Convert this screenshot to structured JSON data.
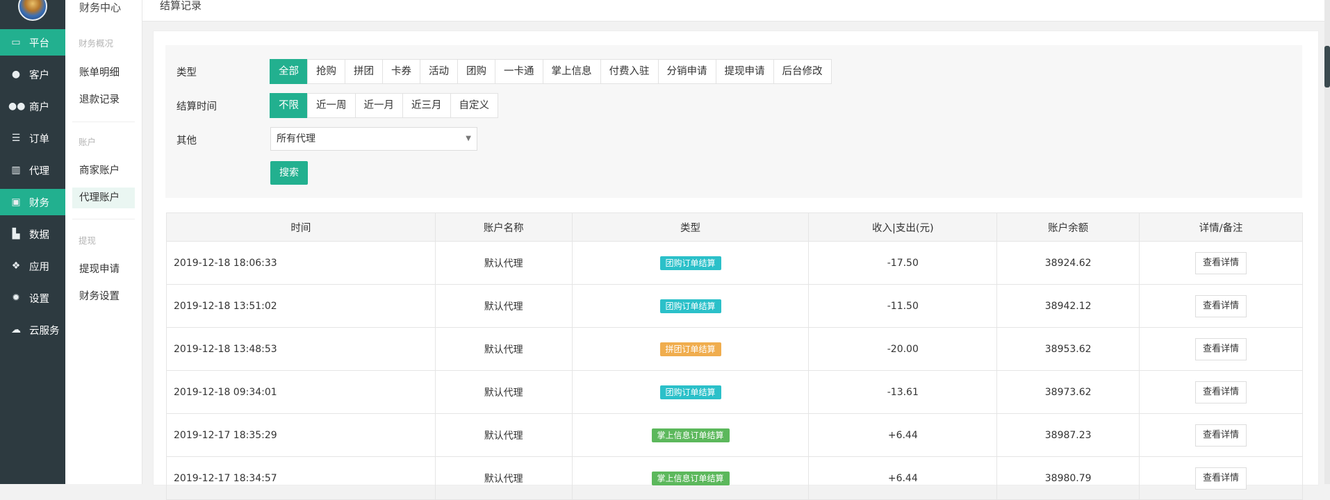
{
  "nav": {
    "items": [
      {
        "icon": "monitor-icon",
        "glyph": "▭",
        "label": "平台",
        "active": true
      },
      {
        "icon": "user-icon",
        "glyph": "●",
        "label": "客户",
        "active": false
      },
      {
        "icon": "users-icon",
        "glyph": "●●",
        "label": "商户",
        "active": false
      },
      {
        "icon": "list-icon",
        "glyph": "☰",
        "label": "订单",
        "active": false
      },
      {
        "icon": "map-icon",
        "glyph": "▥",
        "label": "代理",
        "active": false
      },
      {
        "icon": "money-icon",
        "glyph": "▣",
        "label": "财务",
        "active": true
      },
      {
        "icon": "bar-chart-icon",
        "glyph": "▙",
        "label": "数据",
        "active": false
      },
      {
        "icon": "cubes-icon",
        "glyph": "❖",
        "label": "应用",
        "active": false
      },
      {
        "icon": "gear-icon",
        "glyph": "✹",
        "label": "设置",
        "active": false
      },
      {
        "icon": "cloud-icon",
        "glyph": "☁",
        "label": "云服务",
        "active": false
      }
    ]
  },
  "sub": {
    "title": "财务中心",
    "group1": "财务概况",
    "link1": "账单明细",
    "link2": "退款记录",
    "group2": "账户",
    "link3": "商家账户",
    "link4": "代理账户",
    "group3": "提现",
    "link5": "提现申请",
    "link6": "财务设置"
  },
  "topbar": {
    "crumb": "结算记录"
  },
  "filter": {
    "type_label": "类型",
    "type_options": [
      "全部",
      "抢购",
      "拼团",
      "卡券",
      "活动",
      "团购",
      "一卡通",
      "掌上信息",
      "付费入驻",
      "分销申请",
      "提现申请",
      "后台修改"
    ],
    "type_selected": "全部",
    "time_label": "结算时间",
    "time_options": [
      "不限",
      "近一周",
      "近一月",
      "近三月",
      "自定义"
    ],
    "time_selected": "不限",
    "other_label": "其他",
    "agent_select_value": "所有代理",
    "search_label": "搜索"
  },
  "table": {
    "headers": [
      "时间",
      "账户名称",
      "类型",
      "收入|支出(元)",
      "账户余额",
      "详情/备注"
    ],
    "rows": [
      {
        "time": "2019-12-18 18:06:33",
        "account": "默认代理",
        "type": "团购订单结算",
        "type_color": "#2bc0c9",
        "amount": "-17.50",
        "balance": "38924.62",
        "detail": "查看详情"
      },
      {
        "time": "2019-12-18 13:51:02",
        "account": "默认代理",
        "type": "团购订单结算",
        "type_color": "#2bc0c9",
        "amount": "-11.50",
        "balance": "38942.12",
        "detail": "查看详情"
      },
      {
        "time": "2019-12-18 13:48:53",
        "account": "默认代理",
        "type": "拼团订单结算",
        "type_color": "#f0ad4e",
        "amount": "-20.00",
        "balance": "38953.62",
        "detail": "查看详情"
      },
      {
        "time": "2019-12-18 09:34:01",
        "account": "默认代理",
        "type": "团购订单结算",
        "type_color": "#2bc0c9",
        "amount": "-13.61",
        "balance": "38973.62",
        "detail": "查看详情"
      },
      {
        "time": "2019-12-17 18:35:29",
        "account": "默认代理",
        "type": "掌上信息订单结算",
        "type_color": "#5cb85c",
        "amount": "+6.44",
        "balance": "38987.23",
        "detail": "查看详情"
      },
      {
        "time": "2019-12-17 18:34:57",
        "account": "默认代理",
        "type": "掌上信息订单结算",
        "type_color": "#5cb85c",
        "amount": "+6.44",
        "balance": "38980.79",
        "detail": "查看详情"
      }
    ]
  },
  "colors": {
    "accent": "#22b08f",
    "nav_bg": "#2d3a40",
    "negative": "#e0472e",
    "positive": "#2a8a2a"
  }
}
